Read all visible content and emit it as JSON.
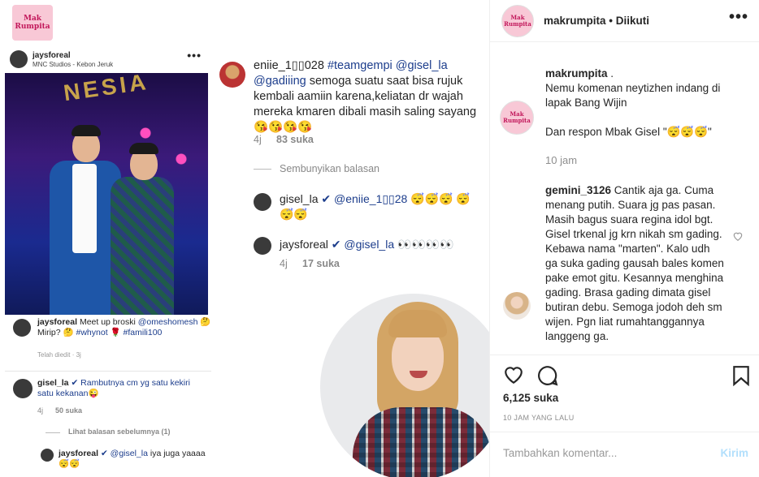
{
  "brand": {
    "logo_text": "Mak Rumpita"
  },
  "screenshot_post": {
    "username": "jaysforeal",
    "location": "MNC Studios - Kebon Jeruk",
    "more": "•••",
    "caption_user": "jaysforeal",
    "caption_text": " Meet up broski",
    "caption_mention": "@omeshomesh",
    "caption_mid": " 🤔 Mirip? 🤔 ",
    "caption_tag1": "#whynot",
    "caption_tag2": "🌹 #famili100",
    "caption_time": "Telah diedit · 3j",
    "comment1_user": "gisel_la",
    "comment1_text": " ✔ Rambutnya cm yg satu kekiri satu kekanan😜",
    "comment1_time": "4j",
    "comment1_likes": "50 suka",
    "view_prev": "Lihat balasan sebelumnya (1)",
    "reply_user": "jaysforeal",
    "reply_mention": " ✔ @gisel_la",
    "reply_text": " iya juga yaaaa 😴😴"
  },
  "screenshot_comments": {
    "main_user": "eniie_1▯▯028",
    "main_tag": " #teamgempi",
    "main_mention": " @gisel_la @gadiiing",
    "main_text": "  semoga suatu saat bisa rujuk kembali aamiin karena,keliatan dr wajah mereka kmaren dibali masih saling sayang😘😘😘😘",
    "main_time": "4j",
    "main_likes": "83 suka",
    "hide_replies": "Sembunyikan balasan",
    "r1_user": "gisel_la",
    "r1_mention": " ✔ @eniie_1▯▯28",
    "r1_text": " 😴😴😴 😴😴😴",
    "r2_user": "jaysforeal",
    "r2_mention": " ✔ @gisel_la",
    "r2_text": " 👀👀👀👀",
    "r2_time": "4j",
    "r2_likes": "17 suka"
  },
  "panel": {
    "header_user": "makrumpita",
    "header_sep": " • ",
    "header_follow": "Diikuti",
    "header_more": "•••",
    "caption_user": "makrumpita",
    "caption_text1": " .",
    "caption_text2": "Nemu komenan neytizhen indang di lapak Bang Wijin",
    "caption_text3": "Dan respon Mbak Gisel \"😴😴😴\"",
    "caption_time": "10 jam",
    "comment_user": "gemini_3126",
    "comment_text": " Cantik aja ga. Cuma menang putih. Suara jg pas pasan. Masih bagus suara regina idol bgt. Gisel trkenal jg krn nikah sm gading. Kebawa nama \"marten\". Kalo udh ga suka gading gausah bales komen pake emot gitu. Kesannya menghina gading. Brasa gading dimata gisel butiran debu. Semoga jodoh deh sm wijen. Pgn liat rumahtanggannya langgeng ga.",
    "likes": "6,125 suka",
    "posted": "10 JAM YANG LALU",
    "add_placeholder": "Tambahkan komentar...",
    "post_label": "Kirim"
  },
  "colors": {
    "link_blue": "#1c3d8c",
    "post_btn": "#b2dffc",
    "meta_gray": "#8e8e8e"
  }
}
